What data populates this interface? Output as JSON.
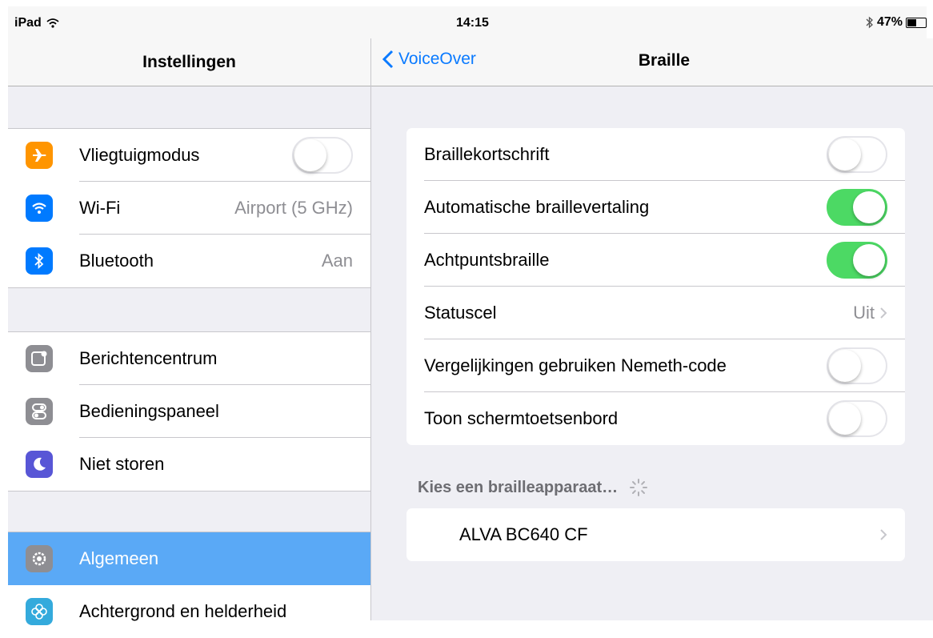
{
  "status_bar": {
    "device": "iPad",
    "time": "14:15",
    "battery": "47%",
    "battery_level": 0.47
  },
  "master": {
    "title": "Instellingen",
    "groups": [
      [
        {
          "label": "Vliegtuigmodus",
          "icon": "airplane-icon",
          "color": "#ff9500",
          "toggle": "off"
        },
        {
          "label": "Wi-Fi",
          "icon": "wifi-icon",
          "color": "#007aff",
          "detail": "Airport (5 GHz)"
        },
        {
          "label": "Bluetooth",
          "icon": "bluetooth-icon",
          "color": "#007aff",
          "detail": "Aan"
        }
      ],
      [
        {
          "label": "Berichtencentrum",
          "icon": "notification-center-icon",
          "color": "#8e8e93"
        },
        {
          "label": "Bedieningspaneel",
          "icon": "control-center-icon",
          "color": "#8e8e93"
        },
        {
          "label": "Niet storen",
          "icon": "moon-icon",
          "color": "#5856d6"
        }
      ],
      [
        {
          "label": "Algemeen",
          "icon": "gear-icon",
          "color": "#8e8e93",
          "selected": true
        },
        {
          "label": "Achtergrond en helderheid",
          "icon": "flower-icon",
          "color": "#34aadc"
        }
      ]
    ]
  },
  "detail": {
    "back_label": "VoiceOver",
    "title": "Braille",
    "settings": [
      {
        "label": "Braillekortschrift",
        "toggle": "off"
      },
      {
        "label": "Automatische braillevertaling",
        "toggle": "on"
      },
      {
        "label": "Achtpuntsbraille",
        "toggle": "on"
      },
      {
        "label": "Statuscel",
        "value": "Uit"
      },
      {
        "label": "Vergelijkingen gebruiken Nemeth-code",
        "toggle": "off"
      },
      {
        "label": "Toon schermtoetsenbord",
        "toggle": "off"
      }
    ],
    "device_section_header": "Kies een brailleapparaat…",
    "devices": [
      {
        "label": "ALVA BC640 CF"
      }
    ]
  },
  "colors": {
    "accent": "#0a7aff",
    "toggle_on": "#4cd964",
    "selected_row": "#5aa9f6"
  }
}
